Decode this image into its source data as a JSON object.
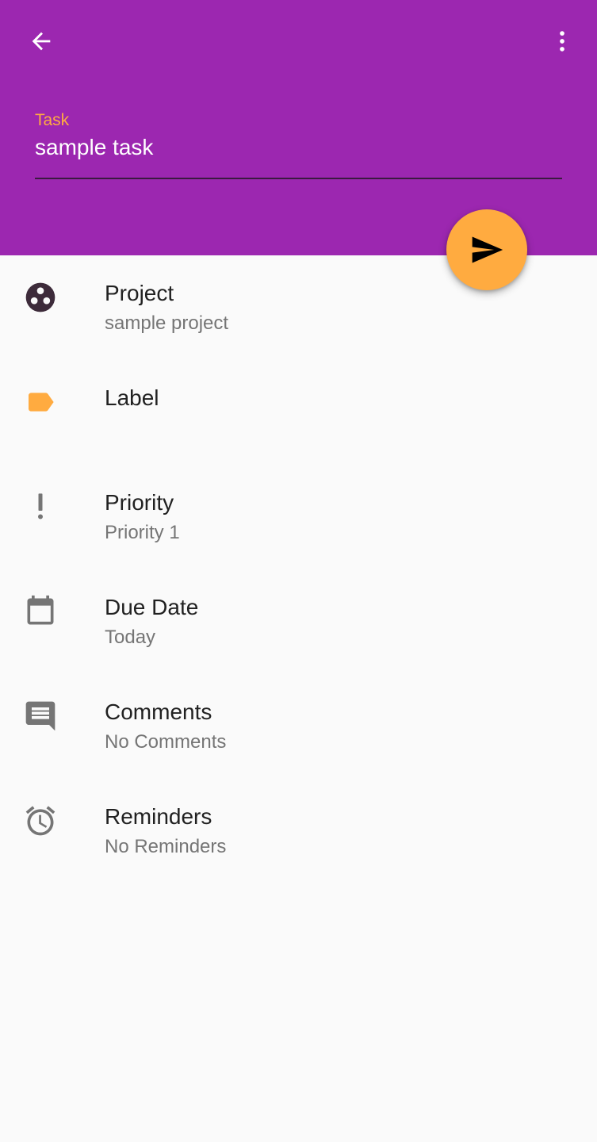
{
  "app_bar": {
    "background": "#9c27b0",
    "back_icon": "arrow-back-icon",
    "menu_icon": "more-vert-icon"
  },
  "task_field": {
    "label": "Task",
    "value": "sample task",
    "label_color": "#ffab40"
  },
  "fab": {
    "icon": "send-icon",
    "color": "#ffab40"
  },
  "rows": [
    {
      "id": "project",
      "icon": "project-icon",
      "title": "Project",
      "subtitle": "sample project"
    },
    {
      "id": "label",
      "icon": "label-icon",
      "title": "Label",
      "subtitle": ""
    },
    {
      "id": "priority",
      "icon": "priority-icon",
      "title": "Priority",
      "subtitle": "Priority 1"
    },
    {
      "id": "due-date",
      "icon": "calendar-icon",
      "title": "Due Date",
      "subtitle": "Today"
    },
    {
      "id": "comments",
      "icon": "comment-icon",
      "title": "Comments",
      "subtitle": "No Comments"
    },
    {
      "id": "reminders",
      "icon": "alarm-icon",
      "title": "Reminders",
      "subtitle": "No Reminders"
    }
  ]
}
